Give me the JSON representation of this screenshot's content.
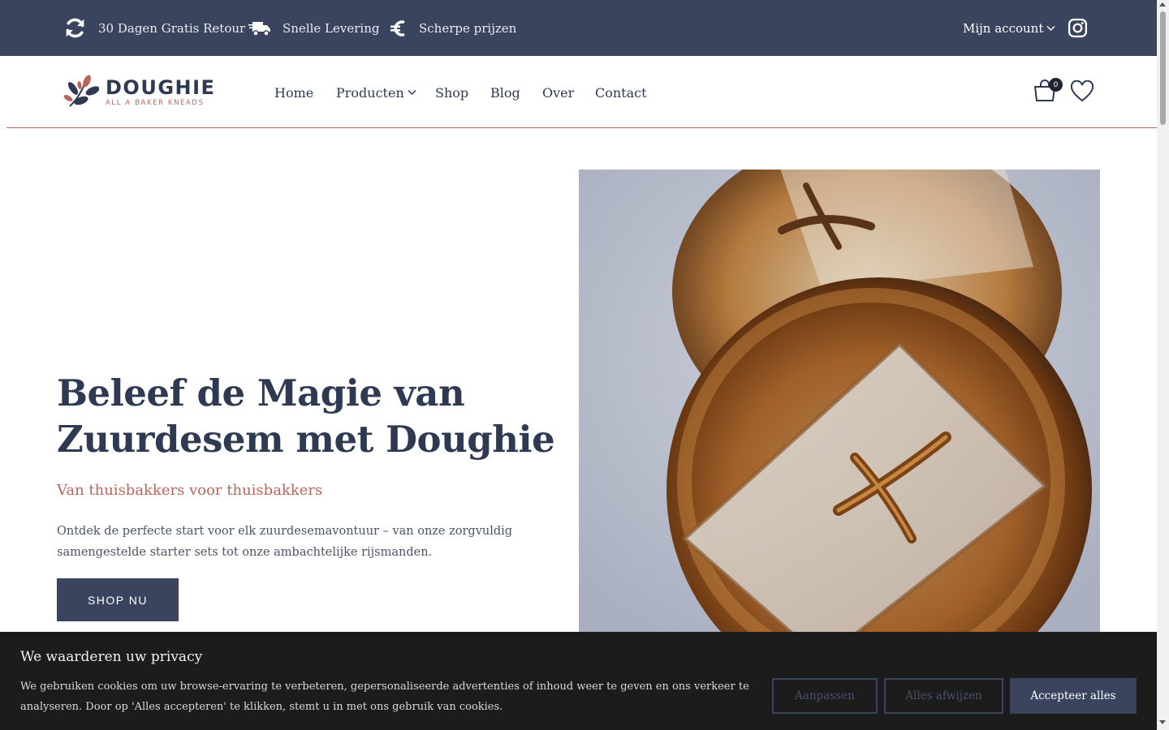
{
  "topbar": {
    "usps": [
      {
        "icon": "refresh-icon",
        "label": "30 Dagen Gratis Retour"
      },
      {
        "icon": "delivery-truck-icon",
        "label": "Snelle Levering"
      },
      {
        "icon": "euro-icon",
        "label": "Scherpe prijzen"
      }
    ],
    "account_label": "Mijn account",
    "social_icon": "instagram-icon"
  },
  "header": {
    "logo_title": "DOUGHIE",
    "logo_tagline": "ALL A BAKER KNEADS",
    "nav": [
      {
        "label": "Home"
      },
      {
        "label": "Producten"
      },
      {
        "label": "Shop"
      },
      {
        "label": "Blog"
      },
      {
        "label": "Over"
      },
      {
        "label": "Contact"
      }
    ],
    "cart_count": "0",
    "cart_icon": "shopping-bag-icon",
    "wishlist_icon": "heart-icon"
  },
  "hero": {
    "title_line1": "Beleef de Magie van",
    "title_line2": "Zuurdesem met Doughie",
    "subtitle": "Van thuisbakkers voor thuisbakkers",
    "text": "Ontdek de perfecte start voor elk zuurdesemavontuur – van onze zorgvuldig samengestelde starter sets tot onze ambachtelijke rijsmanden.",
    "cta": "SHOP NU"
  },
  "cookie": {
    "title": "We waarderen uw privacy",
    "text": "We gebruiken cookies om uw browse-ervaring te verbeteren, gepersonaliseerde advertenties of inhoud weer te geven en ons verkeer te analyseren. Door op 'Alles accepteren' te klikken, stemt u in met ons gebruik van cookies.",
    "customize": "Aanpassen",
    "reject": "Alles afwijzen",
    "accept": "Accepteer alles"
  },
  "colors": {
    "navy": "#3a445f",
    "terracotta": "#b8675a",
    "banner_bg": "#1c1c1c"
  }
}
